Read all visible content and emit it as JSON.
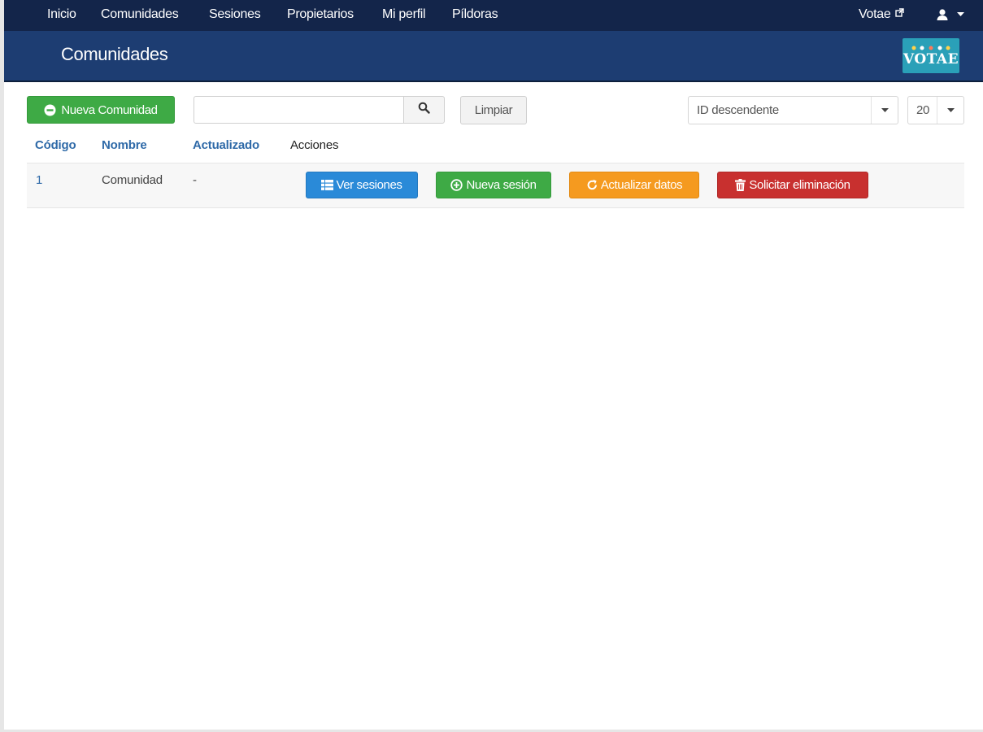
{
  "nav": {
    "items": [
      {
        "label": "Inicio"
      },
      {
        "label": "Comunidades"
      },
      {
        "label": "Sesiones"
      },
      {
        "label": "Propietarios"
      },
      {
        "label": "Mi perfil"
      },
      {
        "label": "Píldoras"
      }
    ],
    "external_link": "Votae",
    "external_icon": "external-link-icon",
    "user_icon": "user-icon"
  },
  "header": {
    "title": "Comunidades",
    "logo_text": "VOTAE"
  },
  "toolbar": {
    "new_button": "Nueva Comunidad",
    "search_value": "",
    "search_placeholder": "",
    "clear_button": "Limpiar",
    "sort_selected": "ID descendente",
    "page_size_selected": "20"
  },
  "table": {
    "columns": [
      "Código",
      "Nombre",
      "Actualizado",
      "Acciones"
    ],
    "rows": [
      {
        "code": "1",
        "name": "Comunidad",
        "updated": "-",
        "actions": [
          "Ver sesiones",
          "Nueva sesión",
          "Actualizar datos",
          "Solicitar eliminación"
        ]
      }
    ]
  },
  "colors": {
    "topnav": "#13254a",
    "header": "#1d3d72",
    "green": "#3eaa45",
    "blue": "#2a8ad8",
    "orange": "#f59a1f",
    "red": "#c8302f",
    "link": "#2f6aa8"
  }
}
